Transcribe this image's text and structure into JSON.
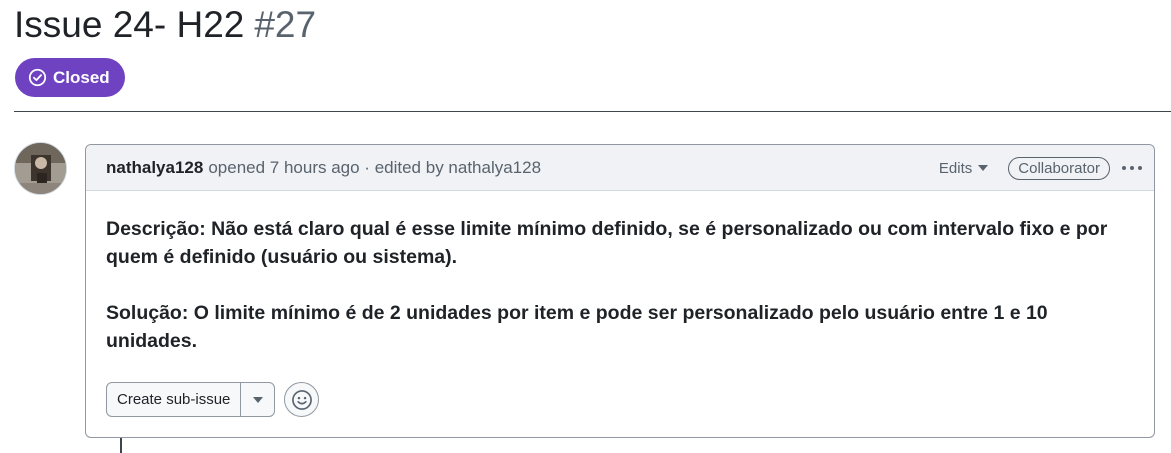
{
  "issue": {
    "title": "Issue 24- H22",
    "number": "#27",
    "state_label": "Closed",
    "state_color": "#6f42c1"
  },
  "comment": {
    "author": "nathalya128",
    "meta": "opened 7 hours ago · edited by nathalya128",
    "edits_label": "Edits",
    "role_badge": "Collaborator",
    "body": [
      "Descrição: Não está claro qual é esse limite mínimo definido, se é personalizado ou com intervalo fixo e por quem é definido (usuário ou sistema).",
      "Solução: O limite mínimo é de 2 unidades por item e pode ser personalizado pelo usuário entre 1 e 10 unidades."
    ]
  },
  "actions": {
    "create_sub_issue": "Create sub-issue"
  },
  "icons": {
    "state": "check-circle-icon",
    "edits": "triangle-down-icon",
    "menu": "kebab-horizontal-icon",
    "dropdown": "triangle-down-icon",
    "reaction": "smiley-icon"
  }
}
